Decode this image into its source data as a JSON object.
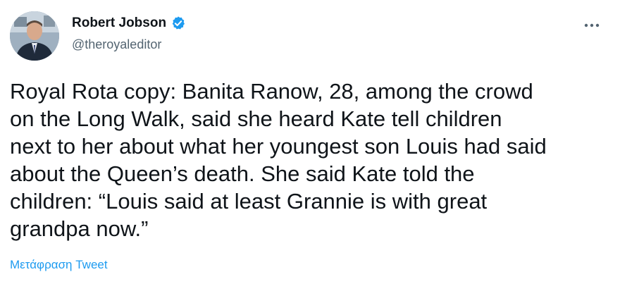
{
  "author": {
    "name": "Robert Jobson",
    "handle": "@theroyaleditor",
    "verified": true
  },
  "menu_icon": "more-horizontal-icon",
  "tweet_lines": [
    "Royal Rota copy: Banita Ranow, 28, among the crowd",
    "on the Long Walk, said she heard Kate tell children",
    "next to her about what her youngest son Louis had said",
    "about the Queen’s death. She said Kate told the",
    "children: “Louis said at least Grannie is with great",
    "grandpa now.”"
  ],
  "translate_label": "Μετάφραση Tweet",
  "colors": {
    "accent": "#1d9bf0",
    "text": "#0f1419",
    "secondary": "#536471"
  }
}
